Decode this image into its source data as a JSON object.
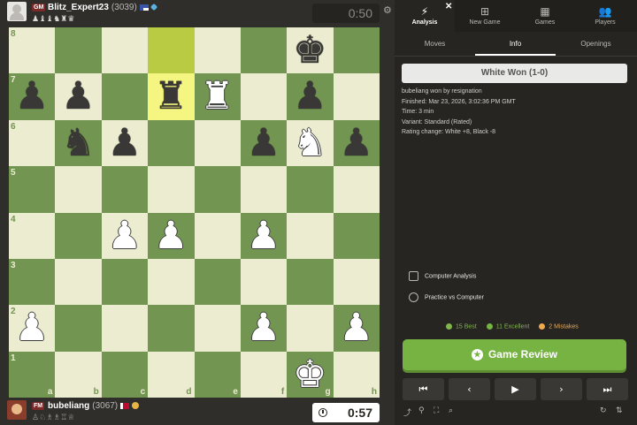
{
  "top_player": {
    "title": "GM",
    "name": "Blitz_Expert23",
    "rating": "(3039)",
    "captured": "♟♝♝♞♜♛",
    "clock": "0:50"
  },
  "bottom_player": {
    "title": "FM",
    "name": "bubeliang",
    "rating": "(3067)",
    "captured": "♙♘♗♗♖♕",
    "clock": "0:57"
  },
  "board": {
    "ranks": [
      "8",
      "7",
      "6",
      "5",
      "4",
      "3",
      "2",
      "1"
    ],
    "files": [
      "a",
      "b",
      "c",
      "d",
      "e",
      "f",
      "g",
      "h"
    ],
    "highlighted": [
      "d8",
      "d7"
    ],
    "pieces": [
      {
        "square": "g8",
        "color": "b",
        "type": "king",
        "glyph": "♚"
      },
      {
        "square": "a7",
        "color": "b",
        "type": "pawn",
        "glyph": "♟"
      },
      {
        "square": "b7",
        "color": "b",
        "type": "pawn",
        "glyph": "♟"
      },
      {
        "square": "d7",
        "color": "b",
        "type": "rook",
        "glyph": "♜"
      },
      {
        "square": "e7",
        "color": "w",
        "type": "rook",
        "glyph": "♜"
      },
      {
        "square": "g7",
        "color": "b",
        "type": "pawn",
        "glyph": "♟"
      },
      {
        "square": "b6",
        "color": "b",
        "type": "knight",
        "glyph": "♞"
      },
      {
        "square": "c6",
        "color": "b",
        "type": "pawn",
        "glyph": "♟"
      },
      {
        "square": "f6",
        "color": "b",
        "type": "pawn",
        "glyph": "♟"
      },
      {
        "square": "g6",
        "color": "w",
        "type": "knight",
        "glyph": "♞"
      },
      {
        "square": "h6",
        "color": "b",
        "type": "pawn",
        "glyph": "♟"
      },
      {
        "square": "c4",
        "color": "w",
        "type": "pawn",
        "glyph": "♟"
      },
      {
        "square": "d4",
        "color": "w",
        "type": "pawn",
        "glyph": "♟"
      },
      {
        "square": "f4",
        "color": "w",
        "type": "pawn",
        "glyph": "♟"
      },
      {
        "square": "a2",
        "color": "w",
        "type": "pawn",
        "glyph": "♟"
      },
      {
        "square": "f2",
        "color": "w",
        "type": "pawn",
        "glyph": "♟"
      },
      {
        "square": "h2",
        "color": "w",
        "type": "pawn",
        "glyph": "♟"
      },
      {
        "square": "g1",
        "color": "w",
        "type": "king",
        "glyph": "♚"
      }
    ]
  },
  "nav": {
    "items": [
      {
        "label": "Analysis",
        "icon": "lightning-icon",
        "glyph": "⚡"
      },
      {
        "label": "New Game",
        "icon": "plus-square-icon",
        "glyph": "⊞"
      },
      {
        "label": "Games",
        "icon": "board-icon",
        "glyph": "▦"
      },
      {
        "label": "Players",
        "icon": "players-icon",
        "glyph": "👥"
      }
    ],
    "close": "✕"
  },
  "subtabs": [
    "Moves",
    "Info",
    "Openings"
  ],
  "result": "White Won (1-0)",
  "info": {
    "line1": "bubeliang won by resignation",
    "line2": "Finished: Mar 23, 2026, 3:02:36 PM GMT",
    "line3": "Time: 3 min",
    "line4": "Variant: Standard (Rated)",
    "line5": "Rating change: White +8, Black -8"
  },
  "actions": {
    "computer_analysis": "Computer Analysis",
    "practice": "Practice vs Computer"
  },
  "stats": {
    "best": "15 Best",
    "excellent": "11 Excellent",
    "mistakes": "2 Mistakes",
    "colors": {
      "best": "#81b64c",
      "excellent": "#77b343",
      "mistakes": "#f0a94d"
    }
  },
  "review_label": "Game Review",
  "controls": {
    "first": "⏮",
    "prev": "‹",
    "play": "▶",
    "next": "›",
    "last": "⏭"
  },
  "tools": {
    "share": "share-icon",
    "explorer": "explorer-icon",
    "flip_view": "expand-icon",
    "analyze": "zoom-icon",
    "rematch": "refresh-icon",
    "swap": "swap-icon"
  },
  "colors": {
    "light_square": "#ebecd0",
    "dark_square": "#739552",
    "highlight_light": "#f5f682",
    "highlight_dark": "#b9ca43",
    "accent_green": "#77b343"
  }
}
